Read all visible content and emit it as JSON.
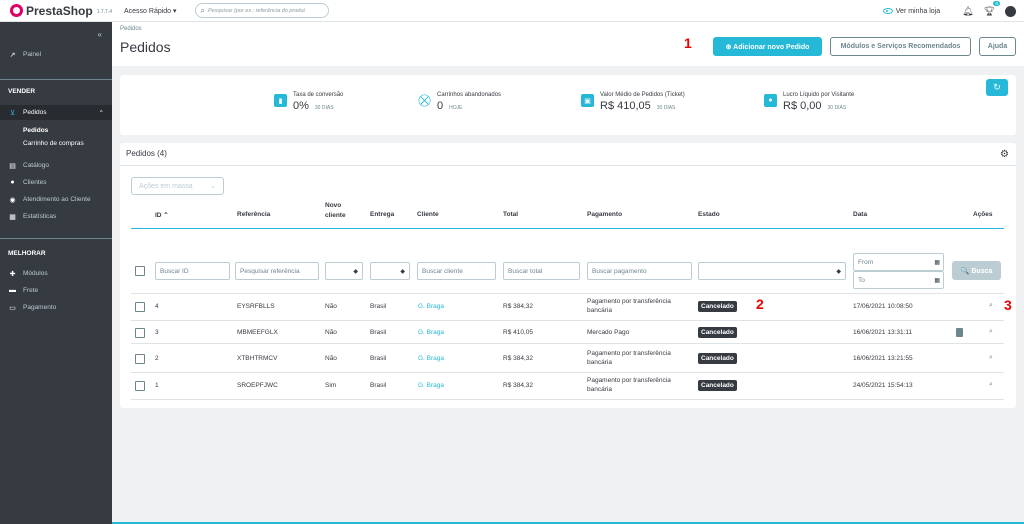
{
  "topbar": {
    "logo_text": "PrestaShop",
    "version": "1.7.7.4",
    "quick_access": "Acesso Rápido ▾",
    "search_placeholder": "Pesquisar (por ex.: referência do produt",
    "view_store": "Ver minha loja",
    "notifications_badge": "0"
  },
  "sidebar": {
    "painel": "Painel",
    "section_vender": "VENDER",
    "pedidos": "Pedidos",
    "sub_pedidos": "Pedidos",
    "sub_carrinhos": "Carrinho de compras",
    "catalogo": "Catálogo",
    "clientes": "Clientes",
    "atendimento": "Atendimento ao Cliente",
    "estatisticas": "Estatísticas",
    "section_melhorar": "MELHORAR",
    "modulos": "Módulos",
    "frete": "Frete",
    "pagamento": "Pagamento"
  },
  "header": {
    "breadcrumb": "Pedidos",
    "title": "Pedidos",
    "add_button": "⊕ Adicionar novo Pedido",
    "modules_button": "Módulos e Serviços Recomendados",
    "help_button": "Ajuda"
  },
  "annotations": {
    "a1": "1",
    "a2": "2",
    "a3": "3"
  },
  "kpis": [
    {
      "label": "Taxa de conversão",
      "value": "0%",
      "period": "30 DIAS"
    },
    {
      "label": "Carrinhos abandonados",
      "value": "0",
      "period": "HOJE"
    },
    {
      "label": "Valor Médio de Pedidos (Ticket)",
      "value": "R$ 410,05",
      "period": "30 DIAS"
    },
    {
      "label": "Lucro Líquido por Visitante",
      "value": "R$ 0,00",
      "period": "30 DIAS"
    }
  ],
  "panel": {
    "title": "Pedidos (4)",
    "bulk_actions": "Ações em massa",
    "headers": {
      "id": "ID ⌃",
      "referencia": "Referência",
      "novo_cliente_1": "Novo",
      "novo_cliente_2": "cliente",
      "entrega": "Entrega",
      "cliente": "Cliente",
      "total": "Total",
      "pagamento": "Pagamento",
      "estado": "Estado",
      "data": "Data",
      "acoes": "Ações"
    },
    "filters": {
      "id": "Buscar ID",
      "referencia": "Pesquisar referência",
      "cliente": "Buscar cliente",
      "total": "Buscar total",
      "pagamento": "Buscar pagamento",
      "from": "From",
      "to": "To",
      "search_button": "🔍 Busca"
    },
    "rows": [
      {
        "id": "4",
        "ref": "EYSRFBLLS",
        "new": "Não",
        "country": "Brasil",
        "customer": "G. Braga",
        "total": "R$ 384,32",
        "pay1": "Pagamento por transferência",
        "pay2": "bancária",
        "status": "Cancelado",
        "date": "17/06/2021 10:08:50"
      },
      {
        "id": "3",
        "ref": "MBMEEFGLX",
        "new": "Não",
        "country": "Brasil",
        "customer": "G. Braga",
        "total": "R$ 410,05",
        "pay1": "Mercado Pago",
        "pay2": "",
        "status": "Cancelado",
        "date": "16/06/2021 13:31:11"
      },
      {
        "id": "2",
        "ref": "XTBHTRMCV",
        "new": "Não",
        "country": "Brasil",
        "customer": "G. Braga",
        "total": "R$ 384,32",
        "pay1": "Pagamento por transferência",
        "pay2": "bancária",
        "status": "Cancelado",
        "date": "16/06/2021 13:21:55"
      },
      {
        "id": "1",
        "ref": "SROEPFJWC",
        "new": "Sim",
        "country": "Brasil",
        "customer": "G. Braga",
        "total": "R$ 384,32",
        "pay1": "Pagamento por transferência",
        "pay2": "bancária",
        "status": "Cancelado",
        "date": "24/05/2021 15:54:13"
      }
    ]
  },
  "colors": {
    "accent": "#25b9d7",
    "sidebar": "#363a41",
    "annotation": "#e00000"
  }
}
